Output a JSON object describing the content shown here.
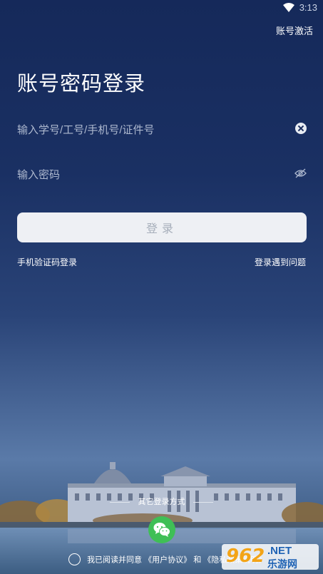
{
  "status_bar": {
    "time": "3:13",
    "wifi_icon": "wifi-icon"
  },
  "header": {
    "activate_account": "账号激活"
  },
  "title": "账号密码登录",
  "form": {
    "account_placeholder": "输入学号/工号/手机号/证件号",
    "account_value": "",
    "password_placeholder": "输入密码",
    "password_value": "",
    "clear_icon": "clear-circle-icon",
    "visibility_icon": "eye-off-icon",
    "login_label": "登录"
  },
  "links": {
    "sms_login": "手机验证码登录",
    "login_help": "登录遇到问题"
  },
  "other_login": {
    "label": "其它登录方式",
    "wechat_icon": "wechat-icon",
    "wechat_color": "#3fbf56"
  },
  "agreement": {
    "prefix": "我已阅读并同意",
    "user_agreement": "《用户协议》",
    "connector": "和",
    "privacy_policy": "《隐私政策说明》"
  },
  "watermark": {
    "number": "962",
    "domain": ".NET",
    "name": "乐游网"
  },
  "colors": {
    "background_top": "#15295a",
    "button_bg": "#eef0f4",
    "button_text": "#a6aeba",
    "wechat": "#3fbf56"
  }
}
